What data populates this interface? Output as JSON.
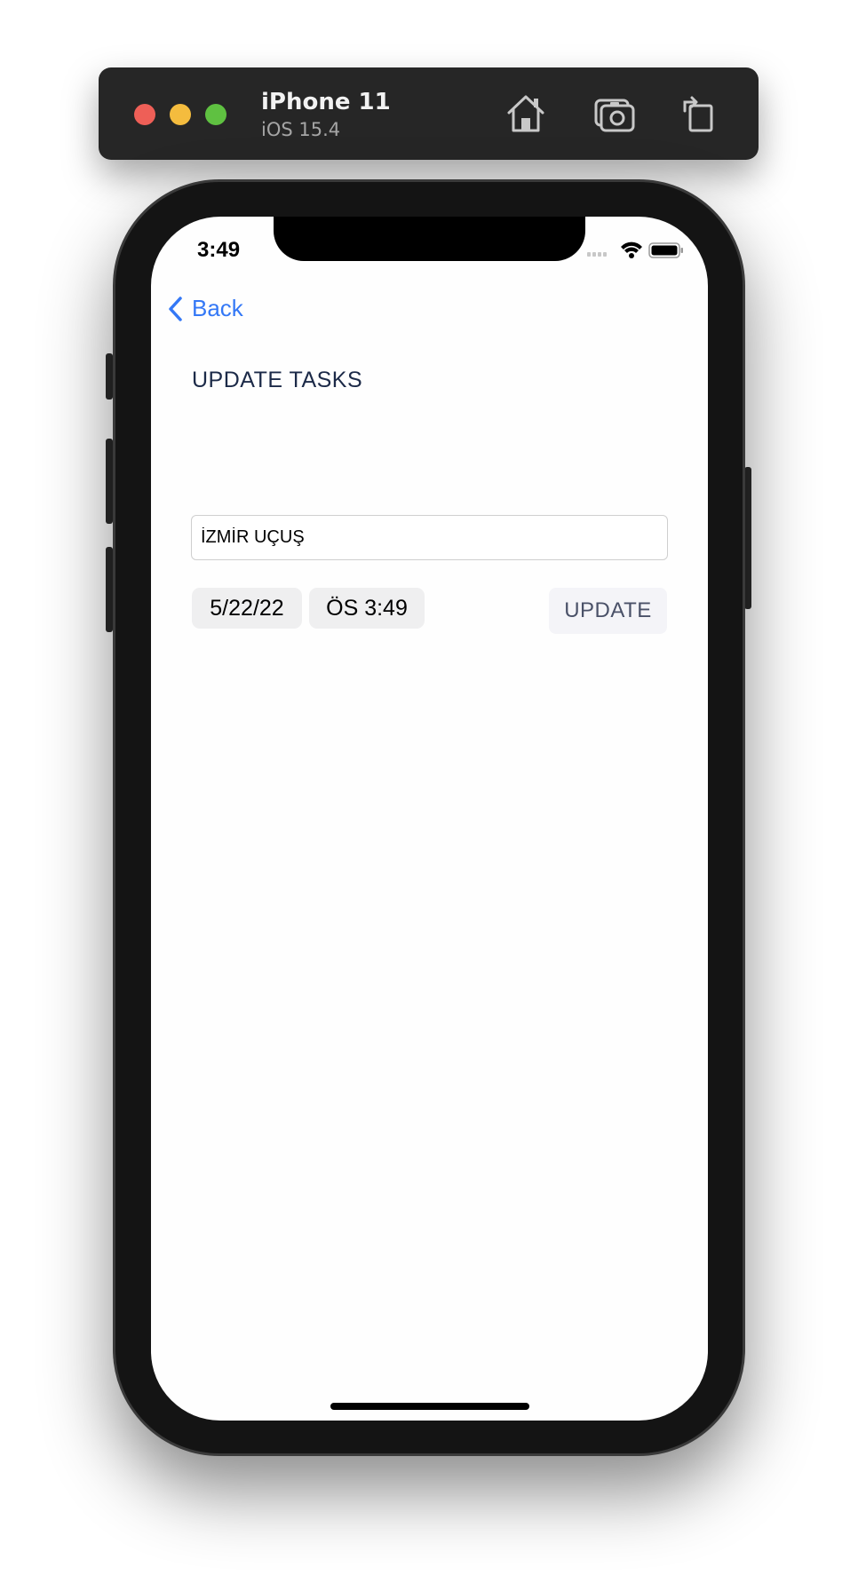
{
  "simulator": {
    "device_name": "iPhone 11",
    "os_version": "iOS 15.4",
    "icons": [
      "home-icon",
      "screenshot-icon",
      "rotate-icon"
    ]
  },
  "status_bar": {
    "time": "3:49",
    "icons": [
      "signal-icon",
      "wifi-icon",
      "battery-icon"
    ]
  },
  "nav": {
    "back_label": "Back"
  },
  "page": {
    "title": "UPDATE TASKS"
  },
  "form": {
    "task_value": "İZMİR UÇUŞ",
    "date_value": "5/22/22",
    "time_value": "ÖS 3:49",
    "update_label": "UPDATE"
  },
  "colors": {
    "accent": "#3478f6",
    "title": "#1c2a48",
    "button_text": "#4a5168"
  }
}
